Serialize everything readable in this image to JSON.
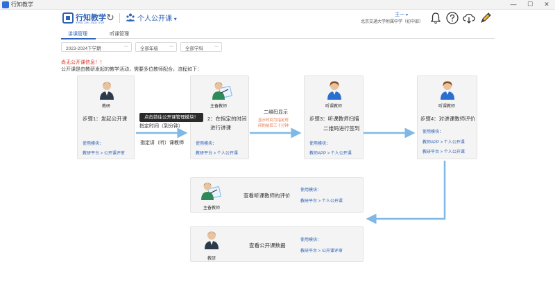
{
  "window": {
    "title": "行知教学",
    "min_glyph": "—",
    "max_glyph": "☐",
    "close_glyph": "✕"
  },
  "header": {
    "logo_name": "行知教学",
    "logo_sub": "XING ZHI JIAO XUE",
    "course_title": "个人公开课",
    "course_caret": "▾",
    "user_name": "王一",
    "user_caret": "▾",
    "user_school": "北京交通大学附属中学（初中部）"
  },
  "tabs": [
    {
      "label": "讲课管理",
      "active": true
    },
    {
      "label": "听课管理",
      "active": false
    }
  ],
  "filters": [
    {
      "value": "2023-2024下学期"
    },
    {
      "value": "全部年级"
    },
    {
      "value": "全部学科"
    }
  ],
  "notice": "尚无公开课信息！！",
  "intro": "公开课是由教研发起的教学活动，需要多位教师配合，流程如下：",
  "cards": {
    "step1": {
      "role": "教研",
      "step": "步骤1：发起公开课",
      "use_label": "使用模块：",
      "path": "教研平台 > 公开课评审"
    },
    "step2": {
      "role": "主备教师",
      "step_line1": "2：在指定的时间",
      "step_line2": "进行讲课",
      "use_label": "使用模块：",
      "path": "教研平台 > 个人公开课"
    },
    "step3": {
      "role": "听课教师",
      "step_line1": "步骤3：听课教师扫描",
      "step_line2": "二维码进行签到",
      "use_label": "使用模块：",
      "path": "教师APP > 个人公开课"
    },
    "step4": {
      "role": "听课教师",
      "step": "步骤4：对讲课教师评价",
      "use_label": "使用模块：",
      "path1": "教师APP > 个人公开课",
      "path2": "教研平台 > 个人公开课"
    },
    "review": {
      "role": "主备教师",
      "text": "查看听课教师的评价",
      "use_label": "使用模块：",
      "path": "教研平台 > 个人公开课"
    },
    "data": {
      "role": "教研",
      "text": "查看公开课数据",
      "use_label": "使用模块：",
      "path": "教研平台 > 公开课评审"
    }
  },
  "annotations": {
    "time_label": "指定时间（到分钟）",
    "teacher_label": "指定讲（听）课教师",
    "qr_label": "二维码显示",
    "qr_hint_line1": "显示时间为指定时",
    "qr_hint_line2": "间的前后三十分钟"
  },
  "tooltip": "点击前往公开课管理模块！",
  "icons": {
    "refresh": "↻",
    "bell": "bell-icon",
    "help": "help-icon",
    "cloud": "cloud-download-icon",
    "pen": "pen-icon"
  },
  "colors": {
    "accent": "#2f63b8",
    "arrow": "#7fb8e6",
    "notice": "#d93025",
    "tooltip_bg": "#2b2b2b"
  }
}
